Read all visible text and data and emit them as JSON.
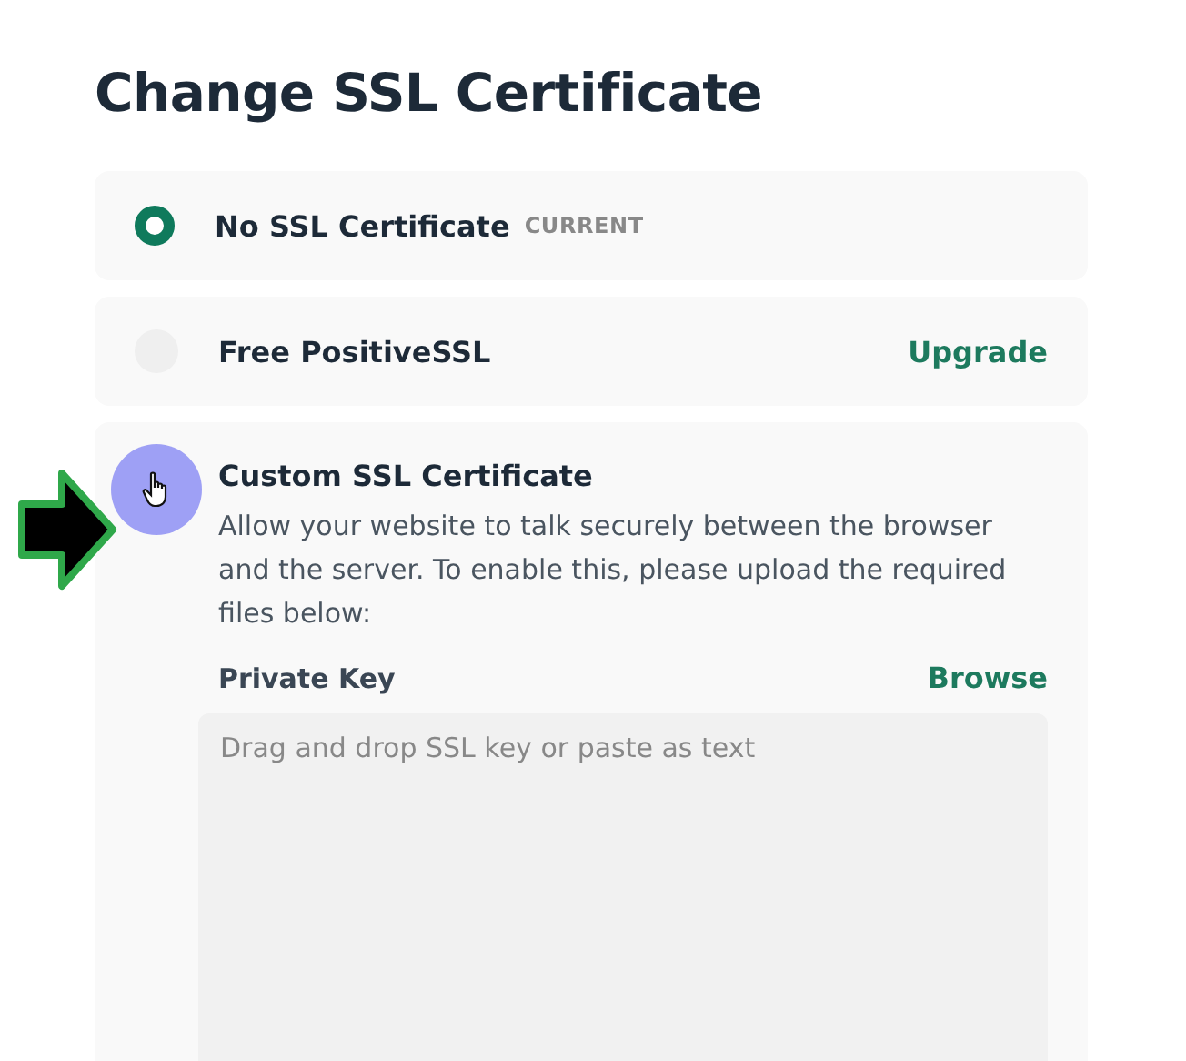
{
  "title": "Change SSL Certificate",
  "options": [
    {
      "kind": "plain",
      "label": "No SSL Certificate",
      "badge": "CURRENT",
      "selected": true,
      "hovered": false
    },
    {
      "kind": "plain",
      "label": "Free PositiveSSL",
      "action": "Upgrade",
      "selected": false,
      "hovered": false
    },
    {
      "kind": "expanded",
      "label": "Custom SSL Certificate",
      "description": "Allow your website to talk securely between the browser and the server. To enable this, please upload the required files below:",
      "selected": false,
      "hovered": true,
      "field": {
        "label": "Private Key",
        "action": "Browse",
        "placeholder": "Drag and drop SSL key or paste as text"
      }
    }
  ]
}
